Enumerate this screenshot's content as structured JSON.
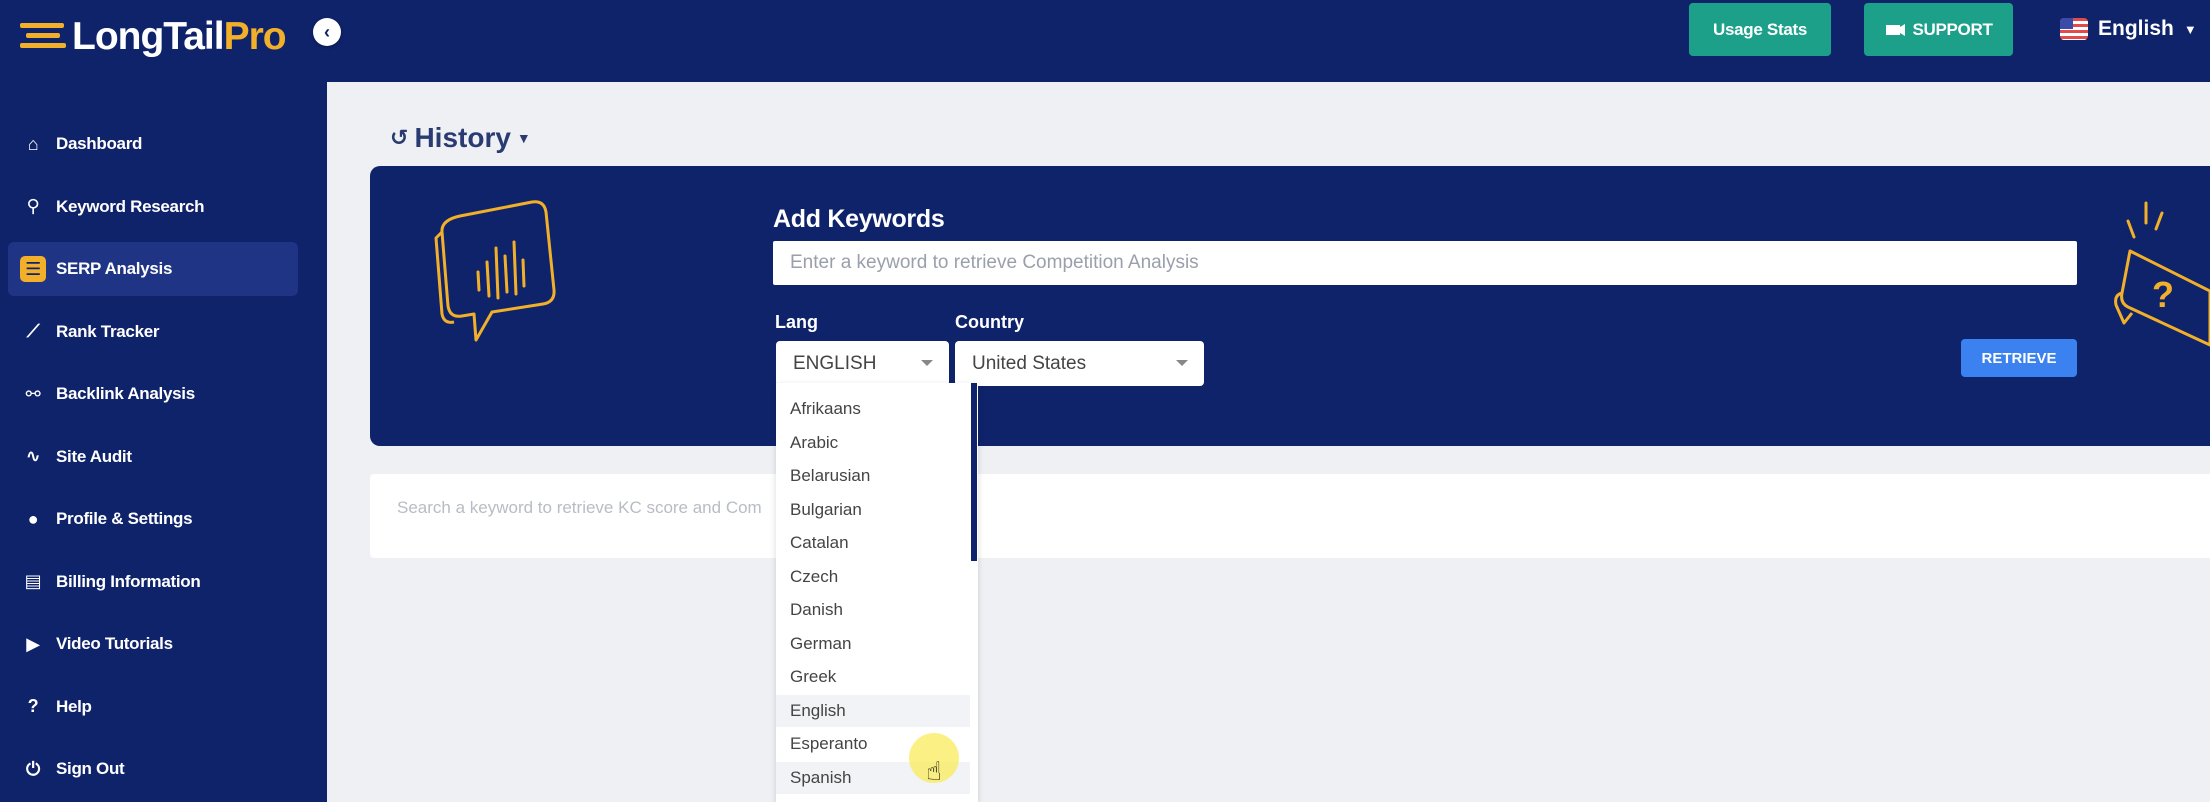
{
  "brand": {
    "logo_main": "LongTail",
    "logo_accent": "Pro",
    "accent_color": "#f2b02a",
    "navy": "#0f236b"
  },
  "sidebar": {
    "collapse_icon": "chevron-left-icon",
    "items": [
      {
        "label": "Dashboard",
        "icon": "home-icon"
      },
      {
        "label": "Keyword Research",
        "icon": "search-icon"
      },
      {
        "label": "SERP Analysis",
        "icon": "list-icon",
        "active": true
      },
      {
        "label": "Rank Tracker",
        "icon": "chart-line-icon"
      },
      {
        "label": "Backlink Analysis",
        "icon": "link-icon"
      },
      {
        "label": "Site Audit",
        "icon": "network-icon"
      },
      {
        "label": "Profile & Settings",
        "icon": "user-icon"
      },
      {
        "label": "Billing Information",
        "icon": "file-icon"
      },
      {
        "label": "Video Tutorials",
        "icon": "youtube-icon"
      },
      {
        "label": "Help",
        "icon": "question-icon"
      },
      {
        "label": "Sign Out",
        "icon": "power-icon"
      }
    ]
  },
  "topbar": {
    "usage_stats": "Usage Stats",
    "support": "SUPPORT",
    "language": "English"
  },
  "main": {
    "history_label": "History",
    "add_keywords_title": "Add Keywords",
    "keyword_placeholder": "Enter a keyword to retrieve Competition Analysis",
    "lang_label": "Lang",
    "country_label": "Country",
    "lang_value": "ENGLISH",
    "country_value": "United States",
    "retrieve_label": "RETRIEVE",
    "results_hint": "Search a keyword to retrieve KC score and Com"
  },
  "lang_dropdown": {
    "options": [
      "Afrikaans",
      "Arabic",
      "Belarusian",
      "Bulgarian",
      "Catalan",
      "Czech",
      "Danish",
      "German",
      "Greek",
      "English",
      "Esperanto",
      "Spanish"
    ],
    "highlighted": [
      "English",
      "Spanish"
    ]
  }
}
